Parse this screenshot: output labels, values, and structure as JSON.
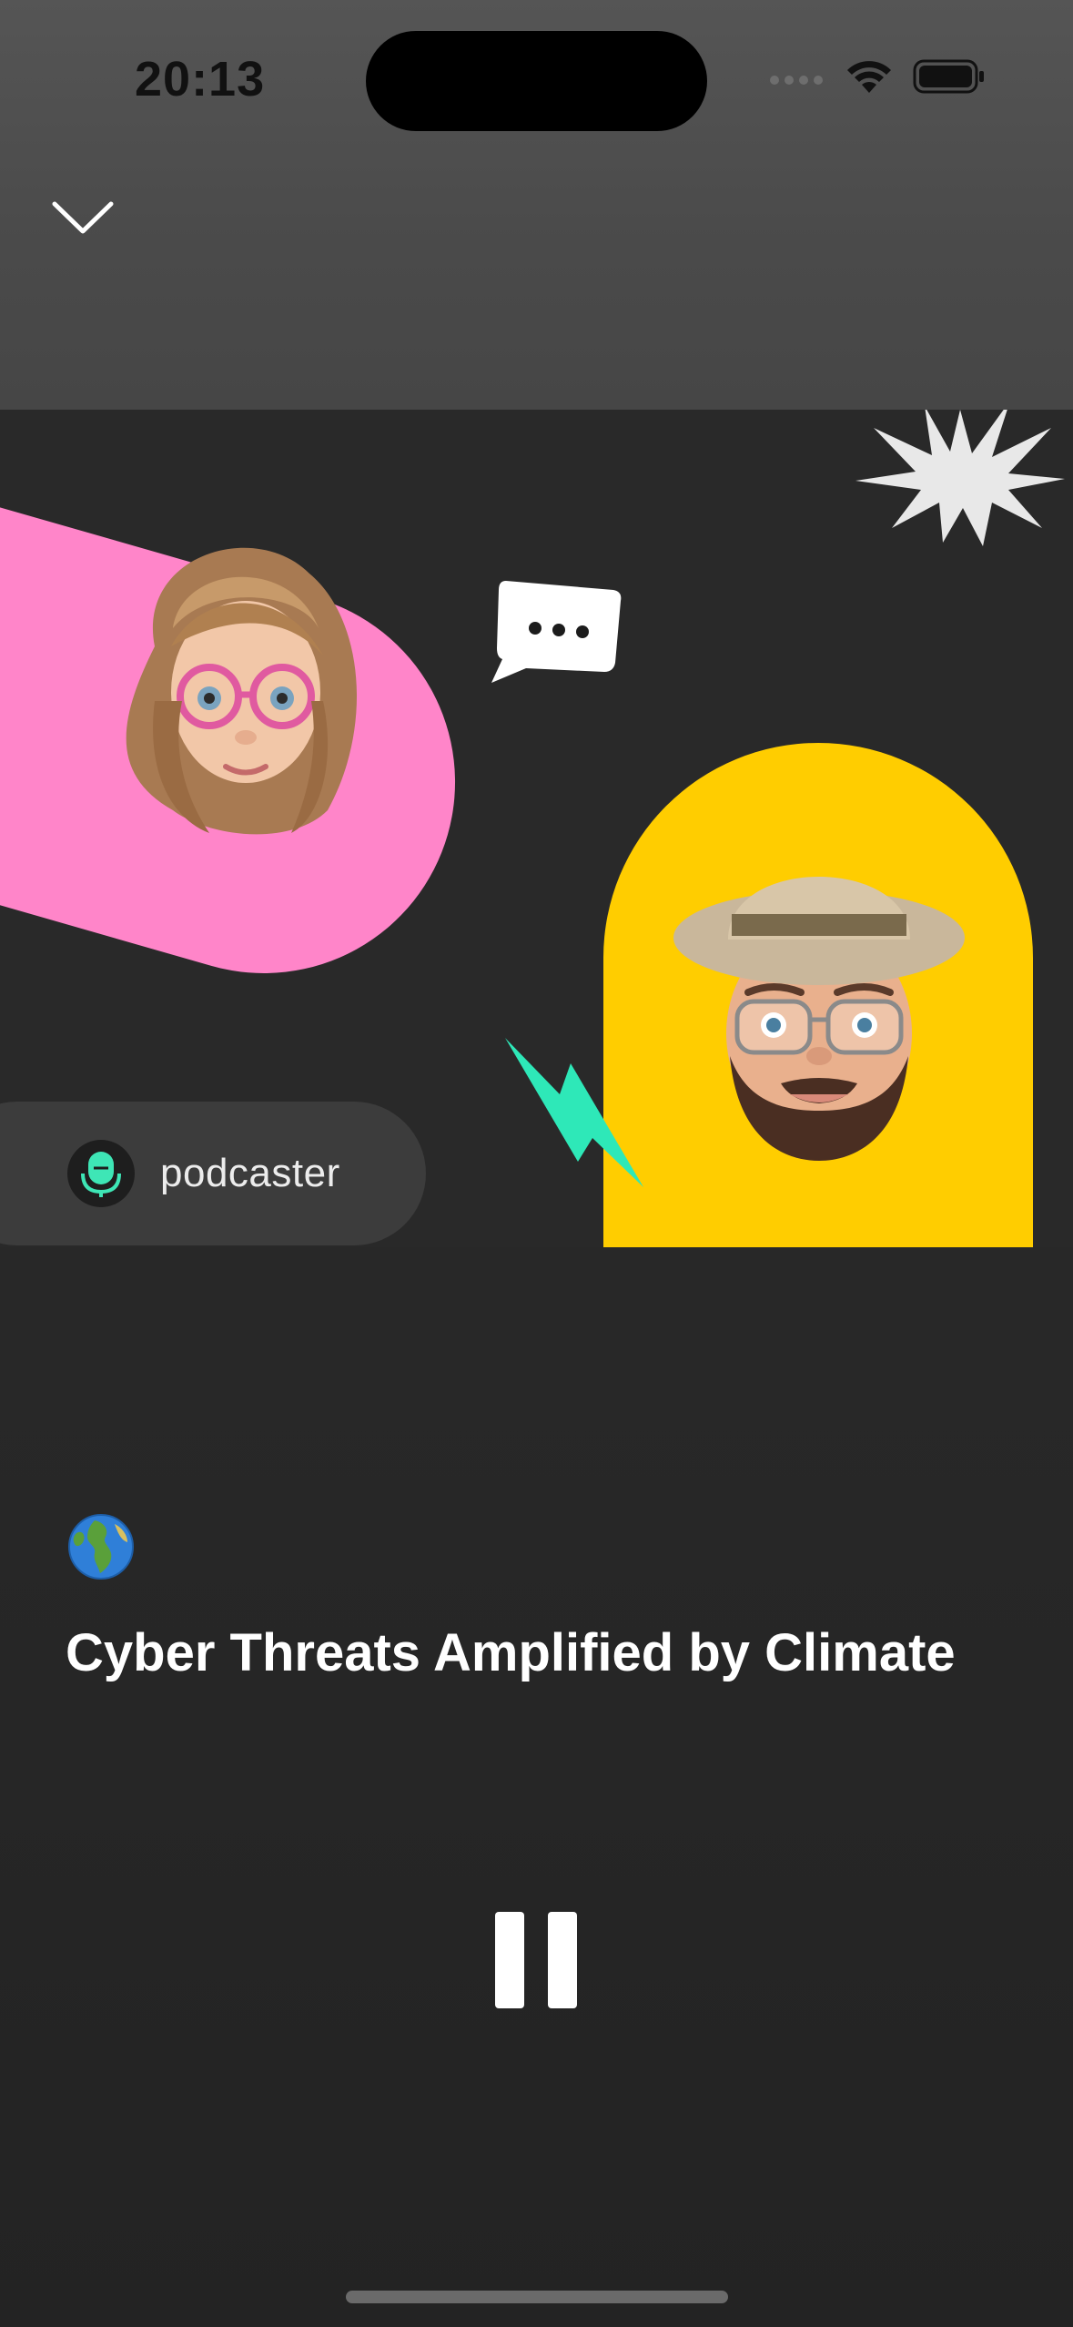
{
  "status_bar": {
    "time": "20:13",
    "icons": [
      "signal-icon",
      "wifi-icon",
      "battery-icon"
    ]
  },
  "header": {
    "collapse_icon": "chevron-down-icon"
  },
  "artwork": {
    "colors": {
      "pink": "#ff85c9",
      "yellow": "#ffcd00",
      "teal": "#2ee8b8",
      "background": "#292929"
    },
    "podcaster_label": "podcaster"
  },
  "episode": {
    "emoji": "🌍",
    "title": "Cyber Threats Amplified by Climate"
  },
  "player": {
    "state_icon": "pause-icon"
  }
}
